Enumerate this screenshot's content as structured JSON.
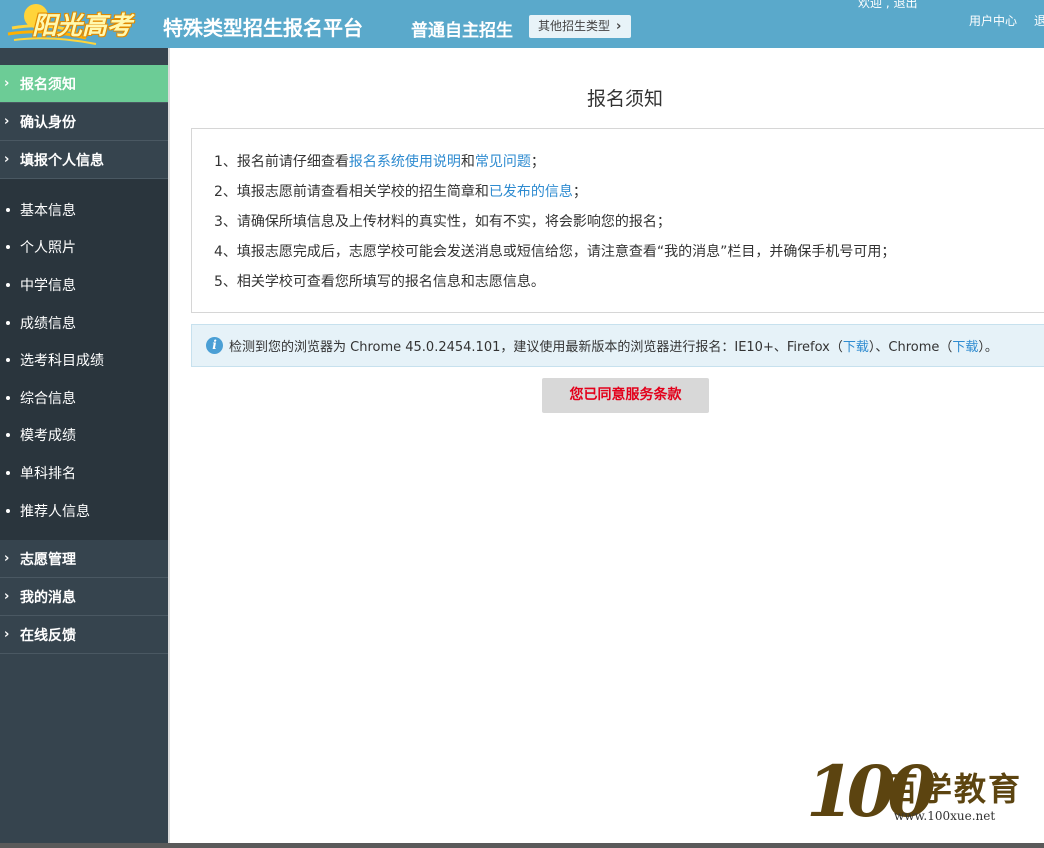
{
  "header": {
    "logo_text": "阳光高考",
    "platform_title": "特殊类型招生报名平台",
    "mode_title": "普通自主招生",
    "other_type_label": "其他招生类型",
    "top_cut_text": "欢迎  ,  退出",
    "user_center": "用户中心",
    "logout": "退"
  },
  "sidebar": {
    "items_top": [
      {
        "label": "报名须知",
        "active": true
      },
      {
        "label": "确认身份"
      },
      {
        "label": "填报个人信息"
      }
    ],
    "sub_items": [
      {
        "label": "基本信息"
      },
      {
        "label": "个人照片"
      },
      {
        "label": "中学信息"
      },
      {
        "label": "成绩信息"
      },
      {
        "label": "选考科目成绩"
      },
      {
        "label": "综合信息"
      },
      {
        "label": "模考成绩"
      },
      {
        "label": "单科排名"
      },
      {
        "label": "推荐人信息"
      }
    ],
    "items_bottom": [
      {
        "label": "志愿管理"
      },
      {
        "label": "我的消息"
      },
      {
        "label": "在线反馈"
      }
    ]
  },
  "main": {
    "title": "报名须知",
    "notice": {
      "item1_prefix": "1、报名前请仔细查看",
      "item1_link1": "报名系统使用说明",
      "item1_mid": "和",
      "item1_link2": "常见问题",
      "item1_suffix": "；",
      "item2_prefix": "2、填报志愿前请查看相关学校的招生简章和",
      "item2_link": "已发布的信息",
      "item2_suffix": "；",
      "item3": "3、请确保所填信息及上传材料的真实性，如有不实，将会影响您的报名；",
      "item4": "4、填报志愿完成后，志愿学校可能会发送消息或短信给您，请注意查看“我的消息”栏目，并确保手机号可用；",
      "item5": "5、相关学校可查看您所填写的报名信息和志愿信息。"
    },
    "browser_alert": {
      "prefix": "检测到您的浏览器为 Chrome 45.0.2454.101，建议使用最新版本的浏览器进行报名：IE10+、Firefox（",
      "link1": "下载",
      "mid": "）、Chrome（",
      "link2": "下载",
      "suffix": "）。"
    },
    "agree_button": "您已同意服务条款"
  },
  "watermark": {
    "number": "100",
    "name": "百学教育",
    "url": "www.100xue.net"
  }
}
